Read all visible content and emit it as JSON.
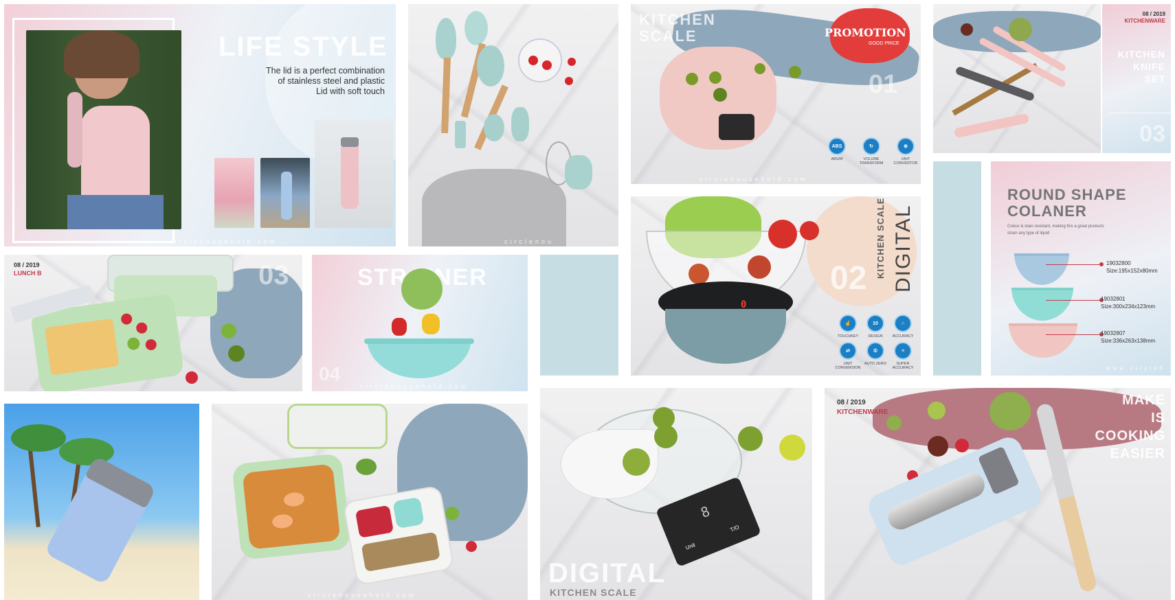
{
  "lifestyle": {
    "title": "LIFE STYLE",
    "desc_1": "The lid is a perfect combination",
    "desc_2": "of stainless steel and plastic",
    "desc_3": "Lid with soft touch",
    "url": "circlehousehold.com"
  },
  "utensils": {
    "url": "circlehou"
  },
  "scale_promo": {
    "title_1": "KITCHEN",
    "title_2": "SCALE",
    "promo_label": "PROMOTION",
    "promo_sub": "GOOD PRICE",
    "number": "01",
    "features": [
      {
        "icon": "ABS",
        "label": "ABS/M"
      },
      {
        "icon": "↻",
        "label": "VOLUME TRANSFORM"
      },
      {
        "icon": "⊕",
        "label": "UNIT CONVERTOR"
      }
    ],
    "url": "circlehousehold.com"
  },
  "knife": {
    "date": "08 / 2019",
    "brand": "KITCHENWARE",
    "title_1": "KITCHEN",
    "title_2": "KNIFE",
    "title_3": "SET",
    "number": "03"
  },
  "lunchbox": {
    "date": "08 / 2019",
    "brand": "LUNCH B",
    "number": "03"
  },
  "strainer": {
    "title": "STRAINER",
    "number": "04",
    "url": "circlehousehold.com"
  },
  "digital_scale": {
    "number": "02",
    "title_1": "KITCHEN SCALE",
    "title_2": "DIGITAL",
    "display": "0",
    "features": [
      {
        "icon": "☝",
        "label": "TOUCHKEY"
      },
      {
        "icon": "10",
        "label": "DESIGN"
      },
      {
        "icon": "∩",
        "label": "ACCURACY"
      },
      {
        "icon": "⇄",
        "label": "UNIT CONVERSION"
      },
      {
        "icon": "①",
        "label": "AUTO ZERO"
      },
      {
        "icon": "≡",
        "label": "SUPER ACCURACY"
      }
    ]
  },
  "colander": {
    "title_1": "ROUND SHAPE",
    "title_2": "COLANER",
    "desc_1": "Colour & stain resistant, making this a great products",
    "desc_2": "strain any type of liquid",
    "items": [
      {
        "code": "19032800",
        "size": "Size:195x152x80mm"
      },
      {
        "code": "19032801",
        "size": "Size:300x234x123mm"
      },
      {
        "code": "19032807",
        "size": "Size:336x263x138mm"
      }
    ],
    "url": "www.circleh"
  },
  "glass_scale": {
    "title_1": "DIGITAL",
    "title_2": "KITCHEN SCALE",
    "key_1": "Unit",
    "key_2": "T/O",
    "display": "8"
  },
  "sharpener": {
    "date": "08 / 2019",
    "brand": "KITCHENWARE",
    "title_1": "MAKE",
    "title_2": "IS",
    "title_3": "COOKING",
    "title_4": "EASIER"
  },
  "lunchbox2": {
    "url": "circlehousehold.com"
  }
}
